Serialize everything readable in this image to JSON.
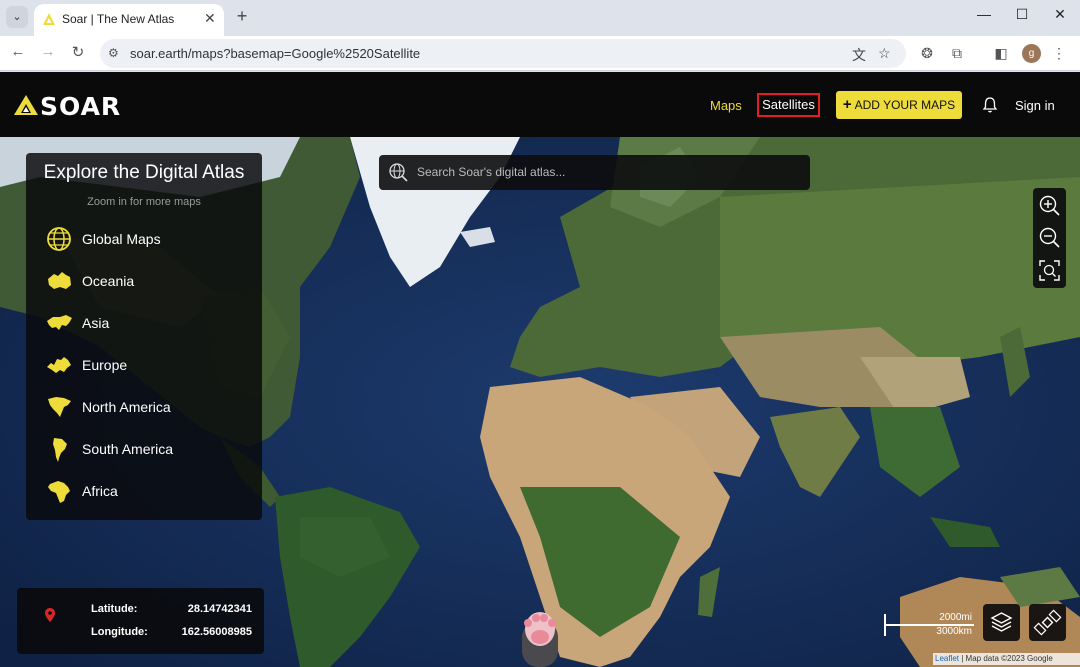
{
  "browser": {
    "tab_title": "Soar | The New Atlas",
    "tab_close": "✕",
    "new_tab": "+",
    "tab_menu": "⌄",
    "url": "soar.earth/maps?basemap=Google%2520Satellite",
    "profile_initial": "g",
    "window_controls": {
      "minimize": "—",
      "maximize": "☐",
      "close": "✕"
    },
    "nav": {
      "back": "←",
      "forward": "→",
      "reload": "↻"
    }
  },
  "header": {
    "logo_text": "SOAR",
    "nav_maps": "Maps",
    "nav_satellites": "Satellites",
    "add_maps_plus": "+",
    "add_maps_label": "ADD YOUR MAPS",
    "sign_in": "Sign in",
    "accent": "#eedc3a"
  },
  "search": {
    "placeholder": "Search Soar's digital atlas..."
  },
  "atlas": {
    "title": "Explore the Digital Atlas",
    "subtitle": "Zoom in for more maps",
    "regions": [
      {
        "label": "Global Maps",
        "icon": "globe-icon"
      },
      {
        "label": "Oceania",
        "icon": "oceania-icon"
      },
      {
        "label": "Asia",
        "icon": "asia-icon"
      },
      {
        "label": "Europe",
        "icon": "europe-icon"
      },
      {
        "label": "North America",
        "icon": "north-america-icon"
      },
      {
        "label": "South America",
        "icon": "south-america-icon"
      },
      {
        "label": "Africa",
        "icon": "africa-icon"
      }
    ]
  },
  "coordinates": {
    "latitude_label": "Latitude:",
    "latitude_value": "28.14742341",
    "longitude_label": "Longitude:",
    "longitude_value": "162.56008985"
  },
  "scale": {
    "imperial": "2000mi",
    "metric": "3000km"
  },
  "attribution": {
    "leaflet": "Leaflet",
    "rest": " | Map data ©2023 Google"
  }
}
